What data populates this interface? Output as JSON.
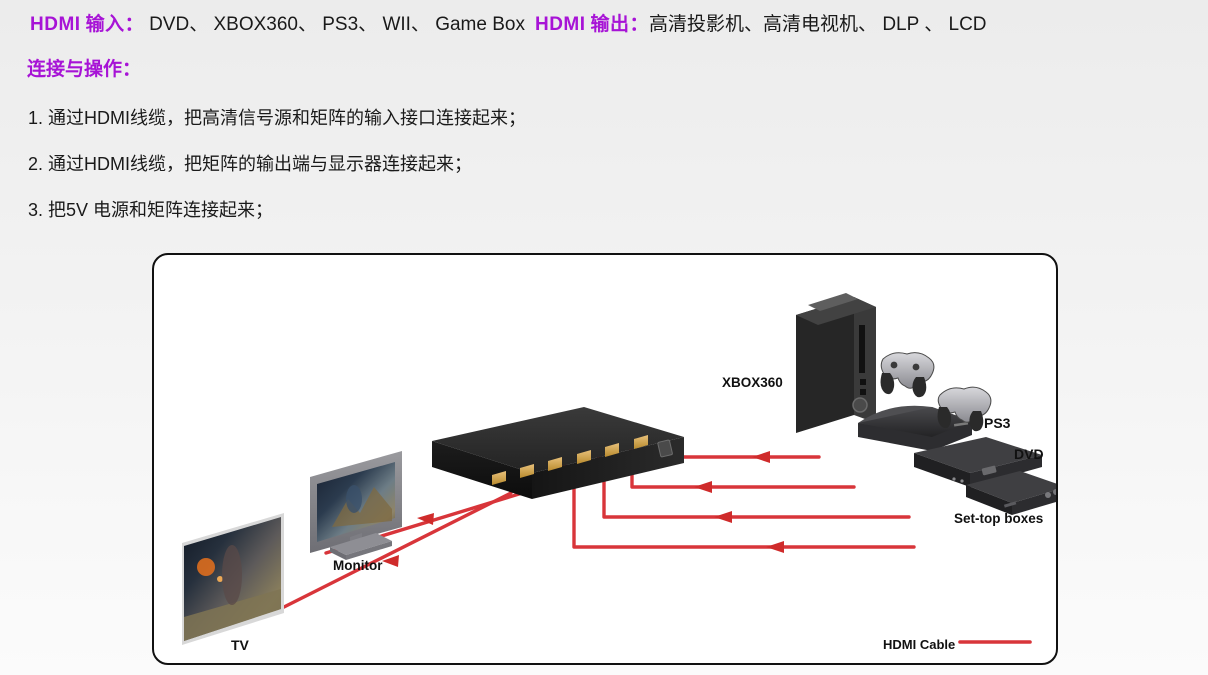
{
  "header": {
    "hdmi_label_1": "HDMI",
    "input_label": "输入：",
    "input_sources": "DVD、 XBOX360、 PS3、 WII、 Game Box",
    "hdmi_label_2": "HDMI",
    "output_label": "输出：",
    "output_devices": "高清投影机、高清电视机、 DLP 、 LCD",
    "accent_color": "#a713d6"
  },
  "section": {
    "title": "连接与操作："
  },
  "steps": [
    "1. 通过HDMI线缆，把高清信号源和矩阵的输入接口连接起来；",
    "2. 通过HDMI线缆，把矩阵的输出端与显示器连接起来；",
    "3. 把5V 电源和矩阵连接起来；"
  ],
  "diagram": {
    "labels": {
      "xbox360": "XBOX360",
      "ps3": "PS3",
      "dvd": "DVD",
      "set_top_boxes": "Set-top boxes",
      "monitor": "Monitor",
      "tv": "TV",
      "hdmi_cable": "HDMI Cable"
    },
    "cable_color": "#d8353a",
    "device_color": "#1b1b1b",
    "port_color": "#d8a441",
    "matrix_ports": 6,
    "border_color": "#111111"
  }
}
